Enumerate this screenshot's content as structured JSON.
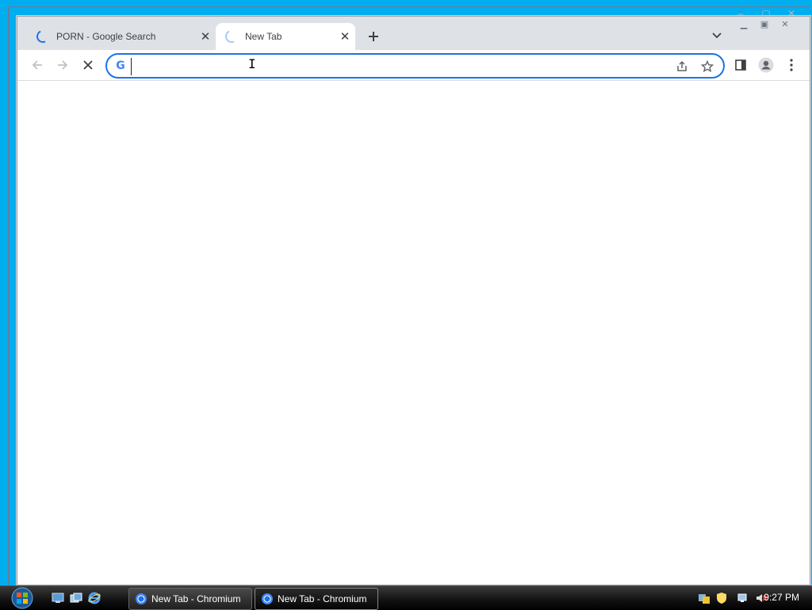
{
  "browser": {
    "tabs": [
      {
        "title": "PORN - Google Search",
        "loading": true
      },
      {
        "title": "New Tab",
        "loading": true,
        "active": true
      }
    ],
    "omnibox": {
      "value": "",
      "placeholder": ""
    },
    "nav": {
      "back": "back-icon",
      "forward": "forward-icon",
      "stop": "stop-icon"
    }
  },
  "taskbar": {
    "tasks": [
      {
        "label": "New Tab - Chromium"
      },
      {
        "label": "New Tab - Chromium",
        "active": true
      }
    ],
    "clock": "9:27 PM"
  },
  "colors": {
    "accent": "#1a73e8",
    "desktop": "#00aeef",
    "tabstrip": "#dee1e6"
  }
}
